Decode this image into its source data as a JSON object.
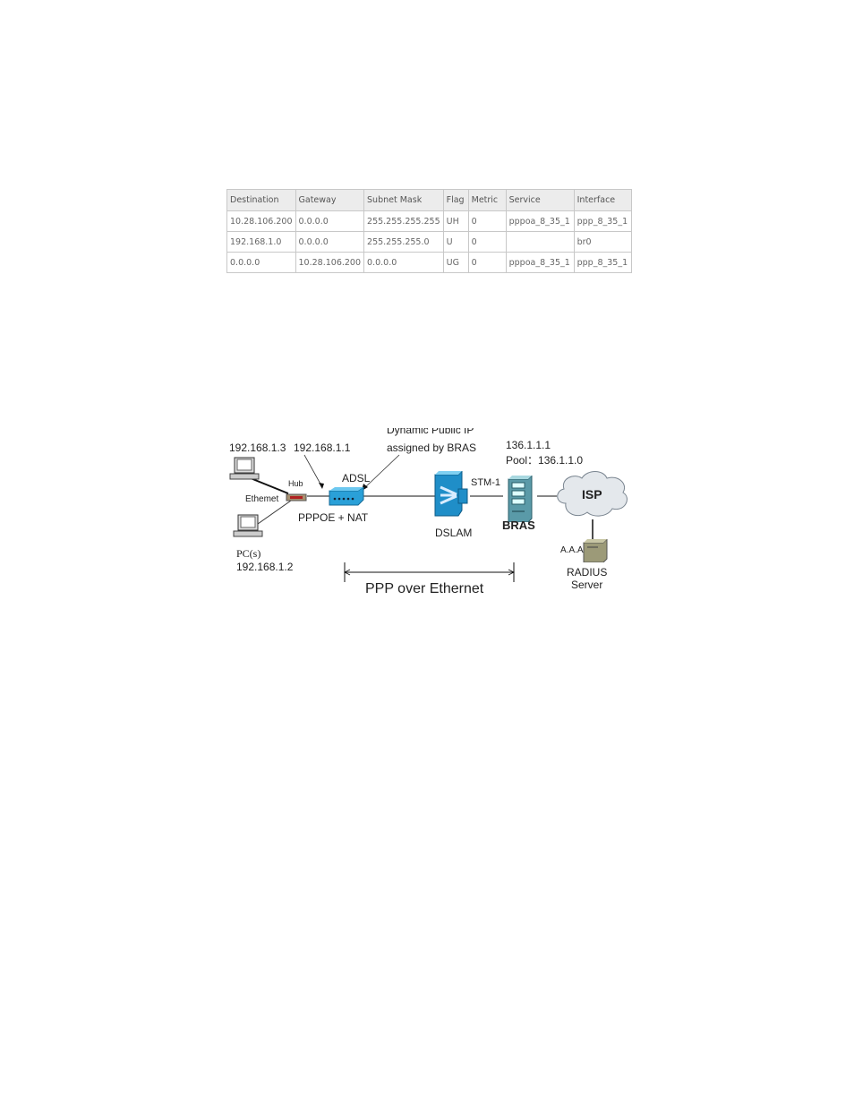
{
  "routing_table": {
    "headers": [
      "Destination",
      "Gateway",
      "Subnet Mask",
      "Flag",
      "Metric",
      "Service",
      "Interface"
    ],
    "rows": [
      [
        "10.28.106.200",
        "0.0.0.0",
        "255.255.255.255",
        "UH",
        "0",
        "pppoa_8_35_1",
        "ppp_8_35_1"
      ],
      [
        "192.168.1.0",
        "0.0.0.0",
        "255.255.255.0",
        "U",
        "0",
        "",
        "br0"
      ],
      [
        "0.0.0.0",
        "10.28.106.200",
        "0.0.0.0",
        "UG",
        "0",
        "pppoa_8_35_1",
        "ppp_8_35_1"
      ]
    ]
  },
  "diagram": {
    "pc1_ip": "192.168.1.3",
    "pc2_label": "PC(s)",
    "pc2_ip": "192.168.1.2",
    "hub_label": "Hub",
    "ethernet_label": "Ethemet",
    "router_ip": "192.168.1.1",
    "adsl_label": "ADSL",
    "router_mode": "PPPOE + NAT",
    "dynamic_ip_line1": "Dynamic Public IP",
    "dynamic_ip_line2": "assigned by BRAS",
    "dslam_label": "DSLAM",
    "stm_label": "STM-1",
    "bras_ip": "136.1.1.1",
    "bras_pool": "Pool：136.1.1.0",
    "bras_label": "BRAS",
    "isp_label": "ISP",
    "aaa_label": "A.A.A",
    "radius_line1": "RADIUS",
    "radius_line2": "Server",
    "span_label": "PPP over Ethernet"
  }
}
